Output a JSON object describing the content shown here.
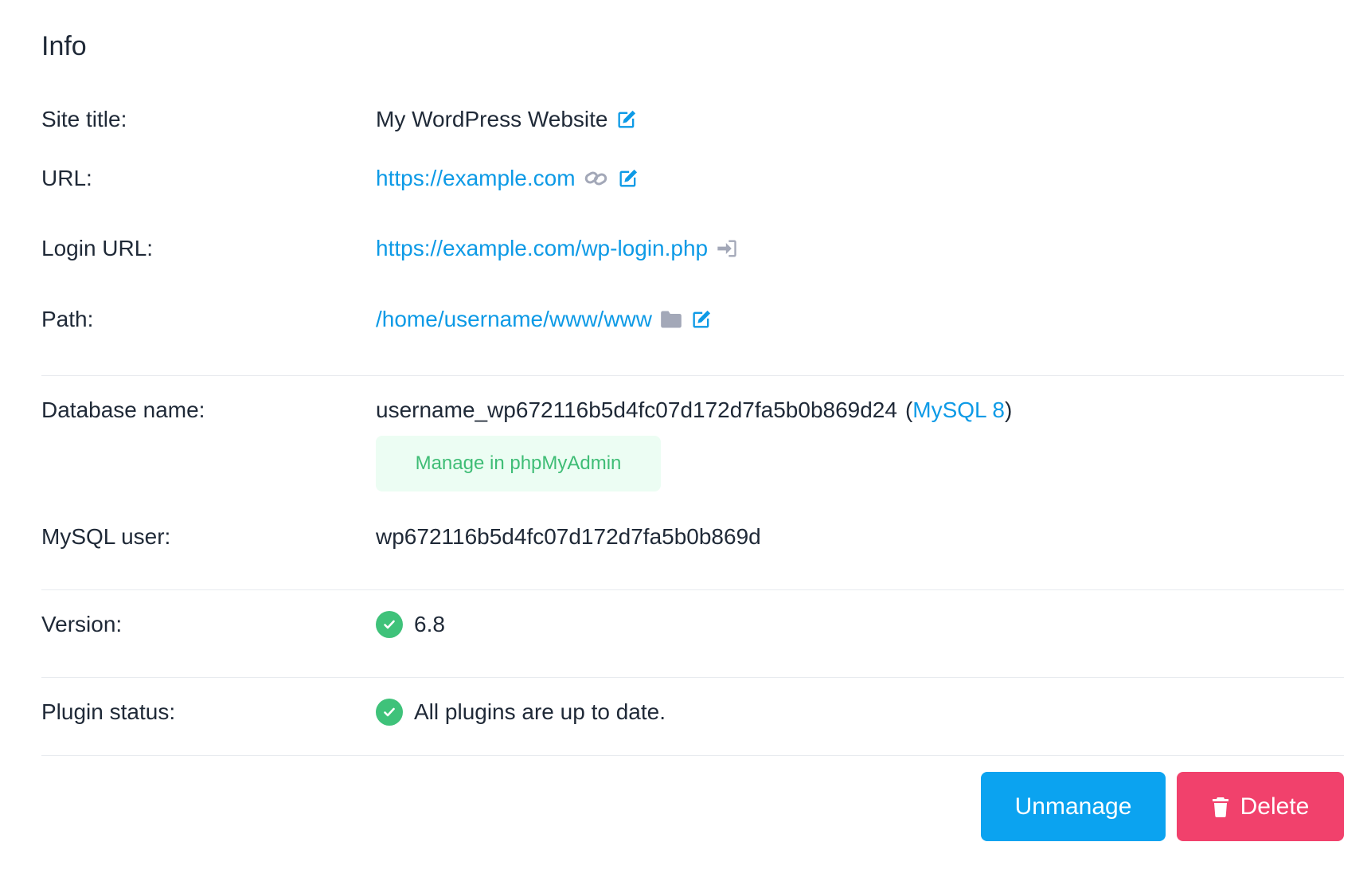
{
  "info": {
    "title": "Info"
  },
  "rows": {
    "site_title": {
      "label": "Site title:",
      "value": "My WordPress Website"
    },
    "url": {
      "label": "URL:",
      "value": "https://example.com"
    },
    "login_url": {
      "label": "Login URL:",
      "value": "https://example.com/wp-login.php"
    },
    "path": {
      "label": "Path:",
      "value": "/home/username/www/www"
    },
    "database": {
      "label": "Database name:",
      "value": "username_wp672116b5d4fc07d172d7fa5b0b869d24",
      "open_paren": "(",
      "engine": "MySQL 8",
      "close_paren": ")",
      "manage_label": "Manage in phpMyAdmin"
    },
    "mysql_user": {
      "label": "MySQL user:",
      "value": "wp672116b5d4fc07d172d7fa5b0b869d"
    },
    "version": {
      "label": "Version:",
      "value": "6.8"
    },
    "plugin_status": {
      "label": "Plugin status:",
      "value": "All plugins are up to date."
    }
  },
  "actions": {
    "unmanage_label": "Unmanage",
    "delete_label": "Delete"
  },
  "icons": {
    "edit": "edit-icon",
    "link": "link-icon",
    "login": "sign-in-icon",
    "folder": "folder-icon",
    "check": "check-circle-icon",
    "trash": "trash-icon"
  },
  "colors": {
    "link": "#0d9ae6",
    "success": "#3fc27a",
    "primary_button": "#0ba3f0",
    "danger_button": "#f1416c",
    "muted_icon": "#a3a8b8"
  }
}
